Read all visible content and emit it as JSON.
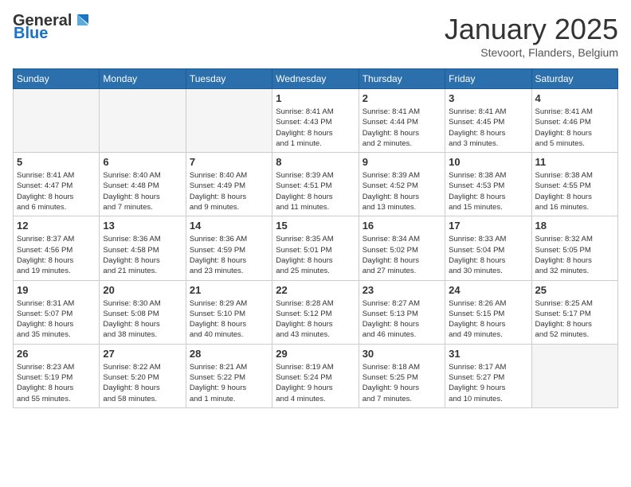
{
  "logo": {
    "general": "General",
    "blue": "Blue"
  },
  "title": "January 2025",
  "location": "Stevoort, Flanders, Belgium",
  "days_of_week": [
    "Sunday",
    "Monday",
    "Tuesday",
    "Wednesday",
    "Thursday",
    "Friday",
    "Saturday"
  ],
  "weeks": [
    [
      {
        "num": "",
        "info": ""
      },
      {
        "num": "",
        "info": ""
      },
      {
        "num": "",
        "info": ""
      },
      {
        "num": "1",
        "info": "Sunrise: 8:41 AM\nSunset: 4:43 PM\nDaylight: 8 hours\nand 1 minute."
      },
      {
        "num": "2",
        "info": "Sunrise: 8:41 AM\nSunset: 4:44 PM\nDaylight: 8 hours\nand 2 minutes."
      },
      {
        "num": "3",
        "info": "Sunrise: 8:41 AM\nSunset: 4:45 PM\nDaylight: 8 hours\nand 3 minutes."
      },
      {
        "num": "4",
        "info": "Sunrise: 8:41 AM\nSunset: 4:46 PM\nDaylight: 8 hours\nand 5 minutes."
      }
    ],
    [
      {
        "num": "5",
        "info": "Sunrise: 8:41 AM\nSunset: 4:47 PM\nDaylight: 8 hours\nand 6 minutes."
      },
      {
        "num": "6",
        "info": "Sunrise: 8:40 AM\nSunset: 4:48 PM\nDaylight: 8 hours\nand 7 minutes."
      },
      {
        "num": "7",
        "info": "Sunrise: 8:40 AM\nSunset: 4:49 PM\nDaylight: 8 hours\nand 9 minutes."
      },
      {
        "num": "8",
        "info": "Sunrise: 8:39 AM\nSunset: 4:51 PM\nDaylight: 8 hours\nand 11 minutes."
      },
      {
        "num": "9",
        "info": "Sunrise: 8:39 AM\nSunset: 4:52 PM\nDaylight: 8 hours\nand 13 minutes."
      },
      {
        "num": "10",
        "info": "Sunrise: 8:38 AM\nSunset: 4:53 PM\nDaylight: 8 hours\nand 15 minutes."
      },
      {
        "num": "11",
        "info": "Sunrise: 8:38 AM\nSunset: 4:55 PM\nDaylight: 8 hours\nand 16 minutes."
      }
    ],
    [
      {
        "num": "12",
        "info": "Sunrise: 8:37 AM\nSunset: 4:56 PM\nDaylight: 8 hours\nand 19 minutes."
      },
      {
        "num": "13",
        "info": "Sunrise: 8:36 AM\nSunset: 4:58 PM\nDaylight: 8 hours\nand 21 minutes."
      },
      {
        "num": "14",
        "info": "Sunrise: 8:36 AM\nSunset: 4:59 PM\nDaylight: 8 hours\nand 23 minutes."
      },
      {
        "num": "15",
        "info": "Sunrise: 8:35 AM\nSunset: 5:01 PM\nDaylight: 8 hours\nand 25 minutes."
      },
      {
        "num": "16",
        "info": "Sunrise: 8:34 AM\nSunset: 5:02 PM\nDaylight: 8 hours\nand 27 minutes."
      },
      {
        "num": "17",
        "info": "Sunrise: 8:33 AM\nSunset: 5:04 PM\nDaylight: 8 hours\nand 30 minutes."
      },
      {
        "num": "18",
        "info": "Sunrise: 8:32 AM\nSunset: 5:05 PM\nDaylight: 8 hours\nand 32 minutes."
      }
    ],
    [
      {
        "num": "19",
        "info": "Sunrise: 8:31 AM\nSunset: 5:07 PM\nDaylight: 8 hours\nand 35 minutes."
      },
      {
        "num": "20",
        "info": "Sunrise: 8:30 AM\nSunset: 5:08 PM\nDaylight: 8 hours\nand 38 minutes."
      },
      {
        "num": "21",
        "info": "Sunrise: 8:29 AM\nSunset: 5:10 PM\nDaylight: 8 hours\nand 40 minutes."
      },
      {
        "num": "22",
        "info": "Sunrise: 8:28 AM\nSunset: 5:12 PM\nDaylight: 8 hours\nand 43 minutes."
      },
      {
        "num": "23",
        "info": "Sunrise: 8:27 AM\nSunset: 5:13 PM\nDaylight: 8 hours\nand 46 minutes."
      },
      {
        "num": "24",
        "info": "Sunrise: 8:26 AM\nSunset: 5:15 PM\nDaylight: 8 hours\nand 49 minutes."
      },
      {
        "num": "25",
        "info": "Sunrise: 8:25 AM\nSunset: 5:17 PM\nDaylight: 8 hours\nand 52 minutes."
      }
    ],
    [
      {
        "num": "26",
        "info": "Sunrise: 8:23 AM\nSunset: 5:19 PM\nDaylight: 8 hours\nand 55 minutes."
      },
      {
        "num": "27",
        "info": "Sunrise: 8:22 AM\nSunset: 5:20 PM\nDaylight: 8 hours\nand 58 minutes."
      },
      {
        "num": "28",
        "info": "Sunrise: 8:21 AM\nSunset: 5:22 PM\nDaylight: 9 hours\nand 1 minute."
      },
      {
        "num": "29",
        "info": "Sunrise: 8:19 AM\nSunset: 5:24 PM\nDaylight: 9 hours\nand 4 minutes."
      },
      {
        "num": "30",
        "info": "Sunrise: 8:18 AM\nSunset: 5:25 PM\nDaylight: 9 hours\nand 7 minutes."
      },
      {
        "num": "31",
        "info": "Sunrise: 8:17 AM\nSunset: 5:27 PM\nDaylight: 9 hours\nand 10 minutes."
      },
      {
        "num": "",
        "info": ""
      }
    ]
  ]
}
